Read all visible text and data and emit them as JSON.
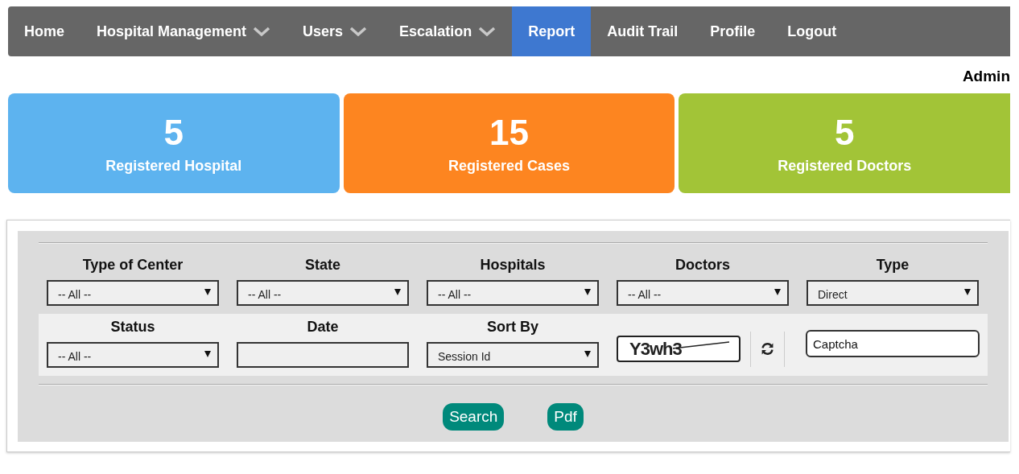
{
  "nav": [
    {
      "label": "Home",
      "dropdown": false,
      "selected": false
    },
    {
      "label": "Hospital Management",
      "dropdown": true,
      "selected": false
    },
    {
      "label": "Users",
      "dropdown": true,
      "selected": false
    },
    {
      "label": "Escalation",
      "dropdown": true,
      "selected": false
    },
    {
      "label": "Report",
      "dropdown": false,
      "selected": true
    },
    {
      "label": "Audit Trail",
      "dropdown": false,
      "selected": false
    },
    {
      "label": "Profile",
      "dropdown": false,
      "selected": false
    },
    {
      "label": "Logout",
      "dropdown": false,
      "selected": false
    }
  ],
  "user": "Admin",
  "stats": [
    {
      "count": "5",
      "label": "Registered Hospital",
      "color": "#5db3ef"
    },
    {
      "count": "15",
      "label": "Registered Cases",
      "color": "#fd8520"
    },
    {
      "count": "5",
      "label": "Registered Doctors",
      "color": "#a2c437"
    }
  ],
  "filters_row_1": [
    {
      "kind": "select",
      "label": "Type of Center",
      "value": "-- All --"
    },
    {
      "kind": "select",
      "label": "State",
      "value": "-- All --"
    },
    {
      "kind": "select",
      "label": "Hospitals",
      "value": "-- All --"
    },
    {
      "kind": "select",
      "label": "Doctors",
      "value": "-- All --"
    },
    {
      "kind": "select",
      "label": "Type",
      "value": "Direct"
    }
  ],
  "filters_row_2": [
    {
      "kind": "select",
      "label": "Status",
      "value": "-- All --"
    },
    {
      "kind": "text",
      "label": "Date"
    },
    {
      "kind": "select",
      "label": "Sort By",
      "value": "Session Id"
    }
  ],
  "captcha": {
    "code": "Y3wh3",
    "placeholder": "Captcha"
  },
  "buttons": [
    "Search",
    "Pdf"
  ]
}
